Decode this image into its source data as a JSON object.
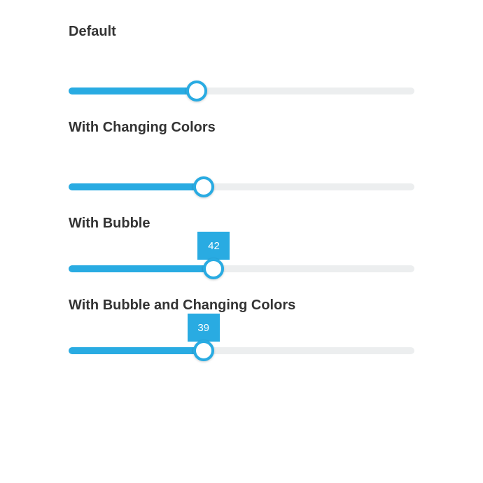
{
  "colors": {
    "accent": "#29abe2",
    "track": "#eceeef"
  },
  "sections": {
    "default": {
      "title": "Default",
      "value": 37,
      "min": 0,
      "max": 100
    },
    "changing_colors": {
      "title": "With Changing Colors",
      "value": 39,
      "min": 0,
      "max": 100
    },
    "bubble": {
      "title": "With Bubble",
      "value": 42,
      "bubble_label": "42",
      "min": 0,
      "max": 100
    },
    "bubble_colors": {
      "title": "With Bubble and Changing Colors",
      "value": 39,
      "bubble_label": "39",
      "min": 0,
      "max": 100
    }
  }
}
